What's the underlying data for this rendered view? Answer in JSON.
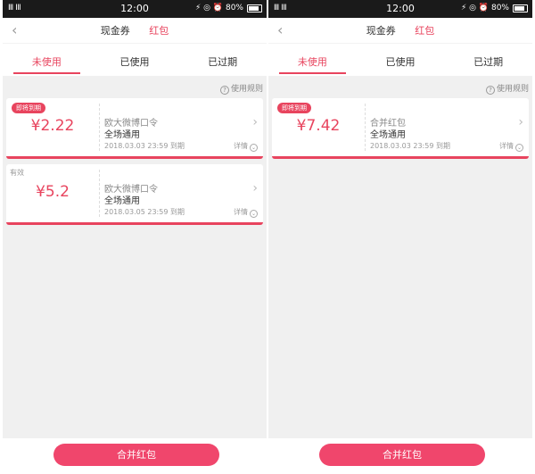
{
  "screens": [
    {
      "status": {
        "time": "12:00",
        "battery": "80%",
        "signal": "Ⅲ ⅠⅡ",
        "icons": "⚡ ◎ ⏰"
      },
      "nav": {
        "back": "‹",
        "title1": "现金券",
        "title2": "红包"
      },
      "tabs": [
        {
          "label": "未使用"
        },
        {
          "label": "已使用"
        },
        {
          "label": "已过期"
        }
      ],
      "rules": {
        "icon": "?",
        "label": "使用规则"
      },
      "cards": [
        {
          "badge": "即将到期",
          "amount": "¥2.22",
          "name": "欧大微博口令",
          "scope": "全场通用",
          "date": "2018.03.03 23:59 到期",
          "detail": "详情"
        },
        {
          "badge": "有效",
          "amount": "¥5.2",
          "name": "欧大微博口令",
          "scope": "全场通用",
          "date": "2018.03.05 23:59 到期",
          "detail": "详情"
        }
      ],
      "merge_button": "合并红包"
    },
    {
      "status": {
        "time": "12:00",
        "battery": "80%",
        "signal": "Ⅲ ⅠⅡ",
        "icons": "⚡ ◎ ⏰"
      },
      "nav": {
        "back": "‹",
        "title1": "现金券",
        "title2": "红包"
      },
      "tabs": [
        {
          "label": "未使用"
        },
        {
          "label": "已使用"
        },
        {
          "label": "已过期"
        }
      ],
      "rules": {
        "icon": "?",
        "label": "使用规则"
      },
      "cards": [
        {
          "badge": "即将到期",
          "amount": "¥7.42",
          "name": "合并红包",
          "scope": "全场通用",
          "date": "2018.03.03 23:59 到期",
          "detail": "详情"
        }
      ],
      "merge_button": "合并红包"
    }
  ],
  "colors": {
    "accent": "#e8445e",
    "button": "#f0466c"
  },
  "icons": {
    "back": "chevron-left-icon",
    "chevron": "chevron-right-icon",
    "help": "help-circle-icon",
    "detail": "chevron-down-circle-icon"
  }
}
